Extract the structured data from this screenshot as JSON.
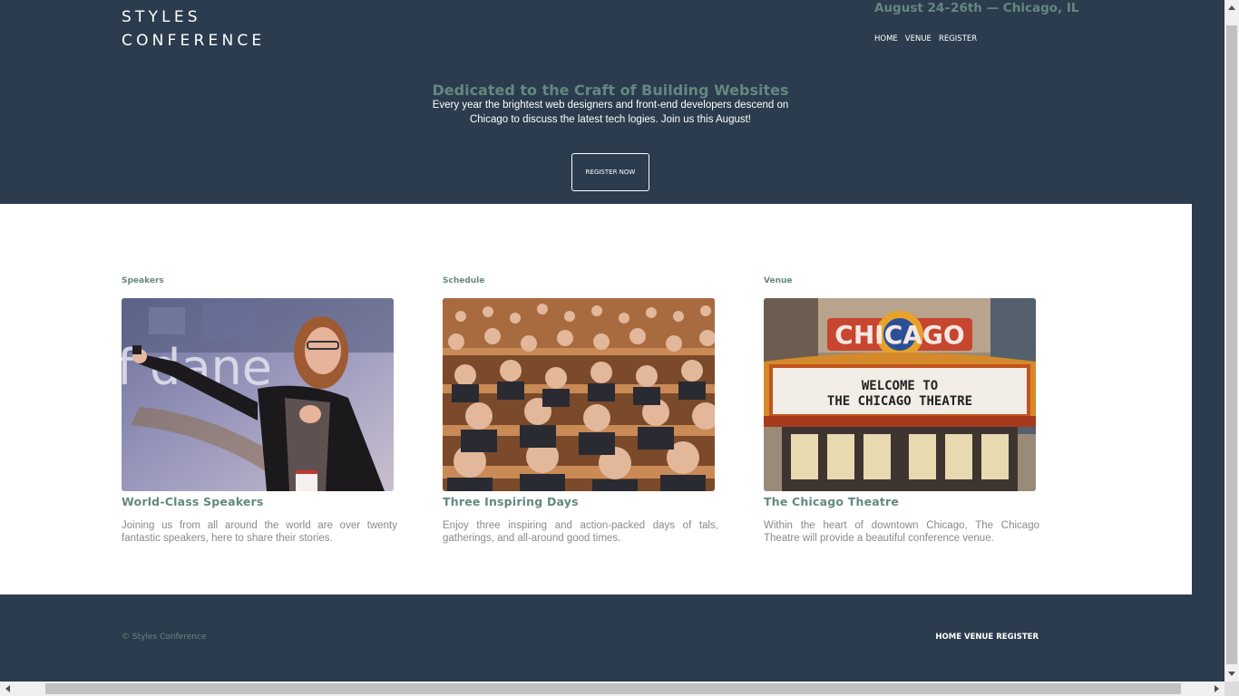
{
  "header": {
    "logo_line1": "STYLES",
    "logo_line2": "CONFERENCE",
    "tagline": "August 24–26th — Chicago, IL",
    "nav": [
      "HOME",
      "VENUE",
      "REGISTER"
    ]
  },
  "hero": {
    "title": "Dedicated to the Craft of Building Websites",
    "text": "Every year the brightest web designers and front-end developers descend on Chicago to discuss the latest tech logies. Join us this August!",
    "button_label": "REGISTER NOW"
  },
  "columns": [
    {
      "label": "Speakers",
      "title": "World-Class Speakers",
      "text": "Joining us from all around the world are over twenty fantastic speakers, here to share their stories.",
      "image_alt": "speaker photo"
    },
    {
      "label": "Schedule",
      "title": "Three Inspiring Days",
      "text": "Enjoy three inspiring and action-packed days of tals, gatherings, and all-around good times.",
      "image_alt": "audience photo"
    },
    {
      "label": "Venue",
      "title": "The Chicago Theatre",
      "text": "Within the heart of downtown Chicago, The Chicago Theatre will provide a beautiful conference venue.",
      "image_alt": "Chicago theatre photo",
      "marquee_sign": "CHICAGO",
      "marquee_line1": "WELCOME TO",
      "marquee_line2": "THE CHICAGO THEATRE"
    }
  ],
  "footer": {
    "copyright": "© Styles Conference",
    "nav": [
      "HOME",
      "VENUE",
      "REGISTER"
    ]
  },
  "colors": {
    "background": "#2a3c4d",
    "accent": "#648880",
    "main_bg": "#ffffff",
    "body_text": "#8a8a8a"
  }
}
